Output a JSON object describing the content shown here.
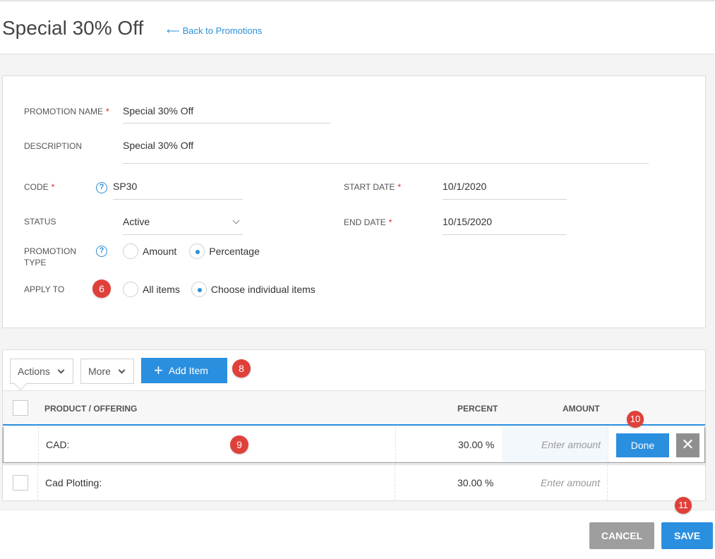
{
  "header": {
    "title": "Special 30% Off",
    "back_arrow": "⟵",
    "back_label": "Back to Promotions"
  },
  "form": {
    "required_mark": "*",
    "help_glyph": "?",
    "promotion_name": {
      "label": "PROMOTION NAME",
      "value": "Special 30% Off"
    },
    "description": {
      "label": "DESCRIPTION",
      "value": "Special 30% Off"
    },
    "code": {
      "label": "CODE",
      "value": "SP30"
    },
    "status": {
      "label": "STATUS",
      "value": "Active"
    },
    "start_date": {
      "label": "START DATE",
      "value": "10/1/2020"
    },
    "end_date": {
      "label": "END DATE",
      "value": "10/15/2020"
    },
    "promotion_type": {
      "label_line1": "PROMOTION",
      "label_line2": "TYPE",
      "options": [
        {
          "label": "Amount",
          "selected": false
        },
        {
          "label": "Percentage",
          "selected": true
        }
      ]
    },
    "apply_to": {
      "label": "APPLY TO",
      "options": [
        {
          "label": "All items",
          "selected": false
        },
        {
          "label": "Choose individual items",
          "selected": true
        }
      ]
    }
  },
  "toolbar": {
    "actions_label": "Actions",
    "more_label": "More",
    "add_item_icon": "+",
    "add_item_label": "Add Item"
  },
  "table": {
    "columns": [
      "PRODUCT / OFFERING",
      "PERCENT",
      "AMOUNT"
    ],
    "rows": [
      {
        "product": "CAD:",
        "percent": "30.00 %",
        "amount_placeholder": "Enter amount",
        "editing": true
      },
      {
        "product": "Cad Plotting:",
        "percent": "30.00 %",
        "amount_placeholder": "Enter amount",
        "editing": false
      }
    ],
    "done_label": "Done",
    "close_glyph": "✕"
  },
  "footer": {
    "cancel_label": "CANCEL",
    "save_label": "SAVE"
  },
  "markers": {
    "m6": "6",
    "m8": "8",
    "m9": "9",
    "m10": "10",
    "m11": "11"
  },
  "colors": {
    "accent": "#2b8fe0",
    "marker": "#e0403a",
    "required": "#e02020",
    "cancel": "#9e9e9e"
  }
}
